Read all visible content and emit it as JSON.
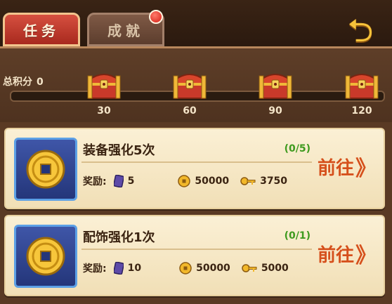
{
  "tabs": [
    {
      "label": "任务",
      "active": true
    },
    {
      "label": "成就",
      "active": false,
      "has_badge": true
    }
  ],
  "score": {
    "label": "总积分",
    "value": "0"
  },
  "chests": [
    {
      "threshold": "30",
      "icon": "treasure-chest-icon"
    },
    {
      "threshold": "60",
      "icon": "treasure-chest-icon"
    },
    {
      "threshold": "90",
      "icon": "treasure-chest-icon"
    },
    {
      "threshold": "120",
      "icon": "treasure-chest-icon"
    }
  ],
  "tasks": [
    {
      "title": "装备强化5次",
      "progress": "(0/5)",
      "reward_label": "奖励:",
      "rewards": [
        {
          "icon": "scroll-icon",
          "value": "5"
        },
        {
          "icon": "coin-icon",
          "value": "50000"
        },
        {
          "icon": "key-icon",
          "value": "3750"
        }
      ],
      "go_label": "前往",
      "go_arrow": "》"
    },
    {
      "title": "配饰强化1次",
      "progress": "(0/1)",
      "reward_label": "奖励:",
      "rewards": [
        {
          "icon": "scroll-icon",
          "value": "10"
        },
        {
          "icon": "coin-icon",
          "value": "50000"
        },
        {
          "icon": "key-icon",
          "value": "5000"
        }
      ],
      "go_label": "前往",
      "go_arrow": "》"
    }
  ],
  "colors": {
    "active_tab": "#c23a2c",
    "inactive_tab": "#6e4c3a",
    "panel": "#5a3a24",
    "card": "#f6e7c4",
    "progress": "#3e9a1e",
    "go_button": "#d5501c"
  }
}
